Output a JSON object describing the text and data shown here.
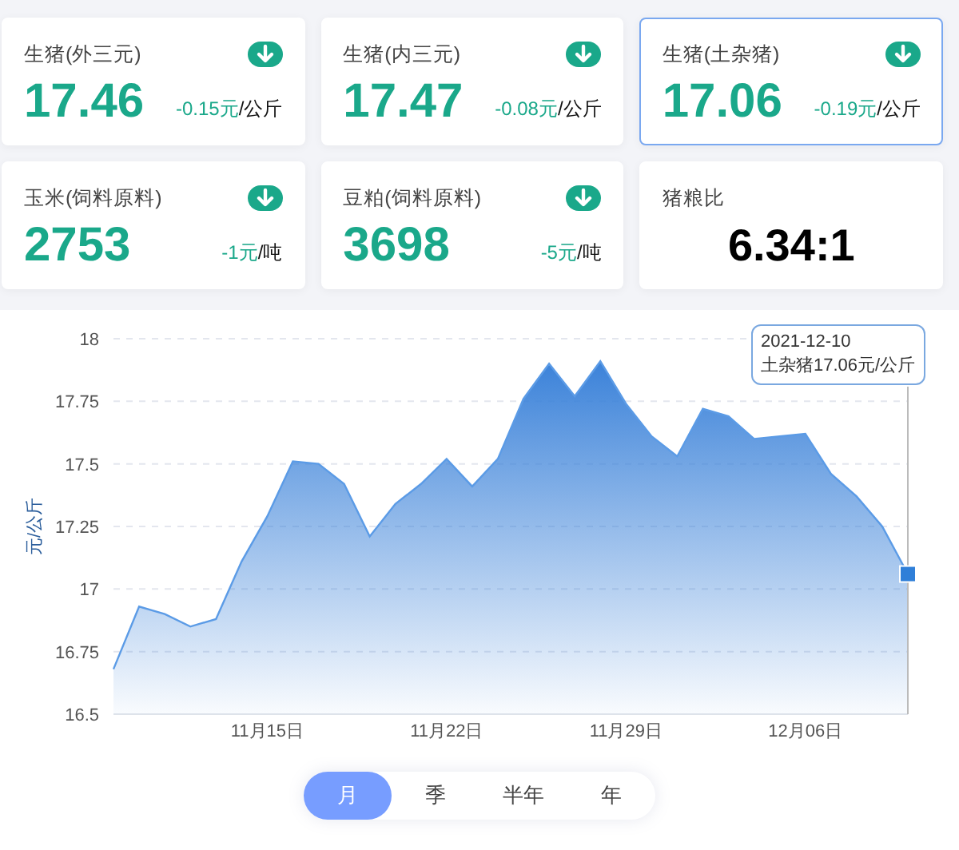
{
  "cards": [
    {
      "kind": "price",
      "label": "生猪(外三元)",
      "value": "17.46",
      "change": "-0.15元",
      "unit": "/公斤",
      "falling": true,
      "selected": false
    },
    {
      "kind": "price",
      "label": "生猪(内三元)",
      "value": "17.47",
      "change": "-0.08元",
      "unit": "/公斤",
      "falling": true,
      "selected": false
    },
    {
      "kind": "price",
      "label": "生猪(土杂猪)",
      "value": "17.06",
      "change": "-0.19元",
      "unit": "/公斤",
      "falling": true,
      "selected": true
    },
    {
      "kind": "price",
      "label": "玉米(饲料原料)",
      "value": "2753",
      "change": "-1元",
      "unit": "/吨",
      "falling": true,
      "selected": false
    },
    {
      "kind": "price",
      "label": "豆粕(饲料原料)",
      "value": "3698",
      "change": "-5元",
      "unit": "/吨",
      "falling": true,
      "selected": false
    },
    {
      "kind": "ratio",
      "label": "猪粮比",
      "value": "6.34:1",
      "selected": false
    }
  ],
  "chart": {
    "chart_data": {
      "type": "area",
      "ylabel": "元/公斤",
      "grid": true,
      "categories": [
        null,
        null,
        null,
        null,
        null,
        null,
        "11月15日",
        null,
        null,
        null,
        null,
        null,
        null,
        "11月22日",
        null,
        null,
        null,
        null,
        null,
        null,
        "11月29日",
        null,
        null,
        null,
        null,
        null,
        null,
        "12月06日",
        null,
        null,
        null,
        null
      ],
      "series": [
        {
          "color": "#3b82d9",
          "values": [
            16.68,
            16.93,
            16.9,
            16.85,
            16.88,
            17.11,
            17.29,
            17.51,
            17.5,
            17.42,
            17.21,
            17.34,
            17.42,
            17.52,
            17.41,
            17.52,
            17.76,
            17.9,
            17.77,
            17.91,
            17.74,
            17.61,
            17.53,
            17.72,
            17.69,
            17.6,
            17.61,
            17.62,
            17.46,
            17.37,
            17.25,
            17.06
          ]
        }
      ],
      "ylim": [
        16.5,
        18
      ],
      "yticks": [
        {
          "value": 16.5,
          "label": "16.5"
        },
        {
          "value": 16.75,
          "label": "16.75"
        },
        {
          "value": 17,
          "label": "17"
        },
        {
          "value": 17.25,
          "label": "17.25"
        },
        {
          "value": 17.5,
          "label": "17.5"
        },
        {
          "value": 17.75,
          "label": "17.75"
        },
        {
          "value": 18,
          "label": "18"
        }
      ]
    },
    "tooltip": {
      "date": "2021-12-10",
      "text": "土杂猪17.06元/公斤"
    }
  },
  "periods": [
    {
      "label": "月",
      "selected": true
    },
    {
      "label": "季",
      "selected": false
    },
    {
      "label": "半年",
      "selected": false
    },
    {
      "label": "年",
      "selected": false
    }
  ]
}
